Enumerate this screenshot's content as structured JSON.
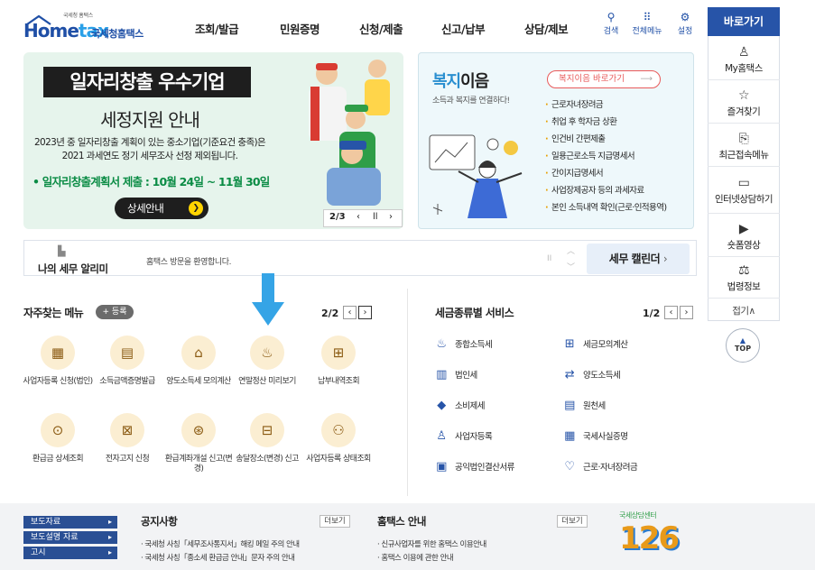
{
  "header": {
    "logo": {
      "small": "국세청 홈택스",
      "brand": "Home",
      "brand2": "tax",
      "kr": "국세청홈택스"
    },
    "nav": [
      "조회/발급",
      "민원증명",
      "신청/제출",
      "신고/납부",
      "상담/제보"
    ],
    "utils": [
      {
        "label": "검색",
        "icon": "search-icon"
      },
      {
        "label": "전체메뉴",
        "icon": "grid-icon"
      },
      {
        "label": "설정",
        "icon": "gear-icon"
      }
    ]
  },
  "quick": {
    "title": "바로가기",
    "items": [
      {
        "label": "My홈택스",
        "icon": "person-icon"
      },
      {
        "label": "즐겨찾기",
        "icon": "star-icon"
      },
      {
        "label": "최근접속메뉴",
        "icon": "recent-icon"
      },
      {
        "label": "인터넷상담하기",
        "icon": "monitor-icon"
      },
      {
        "label": "숏폼영상",
        "icon": "play-icon"
      },
      {
        "label": "법령정보",
        "icon": "gavel-icon"
      }
    ],
    "collapse": "접기∧"
  },
  "banner": {
    "title": "일자리창출 우수기업",
    "subtitle": "세정지원 안내",
    "desc1": "2023년 중 일자리창출 계획이 있는 중소기업(기준요건 충족)은",
    "desc2": "2021 과세연도 정기 세무조사 선정 제외됩니다.",
    "highlight": "• 일자리창출계획서 제출 : 10월 24일 ~ 11월 30일",
    "button": "상세안내",
    "pager": "2/3"
  },
  "welfare": {
    "logo1": "복지",
    "logo2": "이음",
    "tagline": "소득과 복지를 연결하다!",
    "button": "복지이음 바로가기",
    "list": [
      "근로자녀장려금",
      "취업 후 학자금 상환",
      "인건비 간편제출",
      "일용근로소득 지급명세서",
      "간이지급명세서",
      "사업장제공자 등의 과세자료",
      "본인 소득내역 확인(근로·인적용역)"
    ]
  },
  "notice": {
    "label": "나의 세무 알리미",
    "text": "홈택스 방문을 환영합니다.",
    "calendar": "세무 캘린더"
  },
  "favorites": {
    "title": "자주찾는 메뉴",
    "register": "+ 등록",
    "pager": "2/2",
    "items": [
      {
        "label": "사업자등록 신청(법인)",
        "icon": "calendar-icon"
      },
      {
        "label": "소득금액증명발급",
        "icon": "document-icon"
      },
      {
        "label": "양도소득세 모의계산",
        "icon": "house-icon"
      },
      {
        "label": "연말정산 미리보기",
        "icon": "moneybag-icon"
      },
      {
        "label": "납부내역조회",
        "icon": "receipt-search-icon"
      },
      {
        "label": "환급금 상세조회",
        "icon": "refund-icon"
      },
      {
        "label": "전자고지 신청",
        "icon": "notice-icon"
      },
      {
        "label": "환급계좌개설 신고(변경)",
        "icon": "account-icon"
      },
      {
        "label": "송달장소(변경) 신고",
        "icon": "delivery-icon"
      },
      {
        "label": "사업자등록 상태조회",
        "icon": "people-search-icon"
      }
    ]
  },
  "tax_services": {
    "title": "세금종류별 서비스",
    "pager": "1/2",
    "left": [
      {
        "label": "종합소득세",
        "icon": "moneybag-icon"
      },
      {
        "label": "법인세",
        "icon": "building-icon"
      },
      {
        "label": "소비제세",
        "icon": "diamond-icon"
      },
      {
        "label": "사업자등록",
        "icon": "person-icon"
      },
      {
        "label": "공익법인결산서류",
        "icon": "clipboard-icon"
      }
    ],
    "right": [
      {
        "label": "세금모의계산",
        "icon": "calculator-icon"
      },
      {
        "label": "양도소득세",
        "icon": "transfer-icon"
      },
      {
        "label": "원천세",
        "icon": "doc-icon"
      },
      {
        "label": "국세사실증명",
        "icon": "certificate-icon"
      },
      {
        "label": "근로·자녀장려금",
        "icon": "heart-icon"
      }
    ]
  },
  "top_button": "TOP",
  "footer": {
    "side": [
      "보도자료",
      "보도설명 자료",
      "고시"
    ],
    "notice_title": "공지사항",
    "notice_more": "더보기",
    "notice_items": [
      "국세청 사칭「세무조사통지서」해킹 메일 주의 안내",
      "국세청 사칭「종소세 환급금 안내」문자 주의 안내"
    ],
    "guide_title": "홈택스 안내",
    "guide_more": "더보기",
    "guide_items": [
      "신규사업자를 위한 홈택스 이용안내",
      "홈택스 이용에 관한 안내"
    ],
    "center_label": "국세상담센터",
    "center_number": "126"
  }
}
